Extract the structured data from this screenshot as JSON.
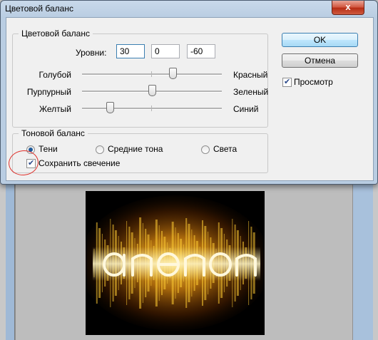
{
  "window": {
    "title": "Цветовой баланс",
    "close_label": "x"
  },
  "color_balance": {
    "group_title": "Цветовой баланс",
    "levels_label": "Уровни:",
    "levels": [
      "30",
      "0",
      "-60"
    ],
    "sliders": [
      {
        "left": "Голубой",
        "right": "Красный",
        "value": 30
      },
      {
        "left": "Пурпурный",
        "right": "Зеленый",
        "value": 0
      },
      {
        "left": "Желтый",
        "right": "Синий",
        "value": -60
      }
    ]
  },
  "tone_balance": {
    "group_title": "Тоновой баланс",
    "options": [
      "Тени",
      "Средние тона",
      "Света"
    ],
    "selected": "Тени",
    "preserve_luminosity": "Сохранить свечение",
    "preserve_checked": true
  },
  "buttons": {
    "ok": "OK",
    "cancel": "Отмена"
  },
  "preview": {
    "label": "Просмотр",
    "checked": true
  },
  "colors": {
    "highlight_circle": "#e0302a",
    "title_bar": "#b9cde2",
    "glow": "#f5b800"
  }
}
